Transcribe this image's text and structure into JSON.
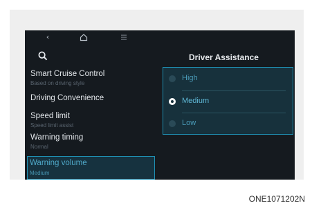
{
  "topbar": {
    "icons": [
      "back-icon",
      "home-icon",
      "menu-icon"
    ]
  },
  "search": {
    "icon": "search-icon"
  },
  "menu": {
    "items": [
      {
        "label": "Smart Cruise Control",
        "sub": "Based on driving style"
      },
      {
        "label": "Driving Convenience",
        "sub": ""
      },
      {
        "label": "Speed limit",
        "sub": "Speed limit assist"
      },
      {
        "label": "Warning timing",
        "sub": "Normal"
      },
      {
        "label": "Warning volume",
        "sub": "Medium",
        "selected": true
      }
    ]
  },
  "panel": {
    "title": "Driver Assistance",
    "options": [
      {
        "label": "High",
        "checked": false
      },
      {
        "label": "Medium",
        "checked": true
      },
      {
        "label": "Low",
        "checked": false
      }
    ]
  },
  "caption": "ONE1071202N",
  "colors": {
    "screen_bg": "#151a1f",
    "accent": "#1f8fb2",
    "selected_bg": "#16323f"
  }
}
